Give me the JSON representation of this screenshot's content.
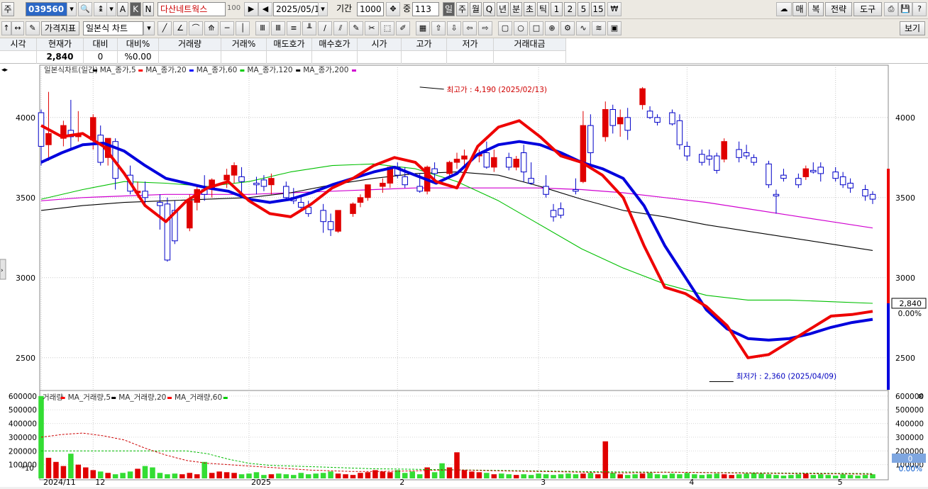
{
  "toolbar1": {
    "type_label": "주",
    "stock_code": "039560",
    "stock_name": "다산네트웍스",
    "name_suffix": "100",
    "date": "2025/05/13",
    "period_label": "기간",
    "period_value": "1000",
    "count_label": "중",
    "count_value": "113",
    "interval_buttons": [
      "일",
      "주",
      "월",
      "Q",
      "년",
      "분",
      "초",
      "틱",
      "1",
      "2",
      "5",
      "15"
    ],
    "right_buttons": [
      "매",
      "복",
      "전략",
      "도구"
    ],
    "a_label": "A",
    "k_label": "K",
    "n_label": "N"
  },
  "toolbar2": {
    "price_index_label": "가격지표",
    "chart_type_label": "일본식 차트",
    "view_label": "보기"
  },
  "info_table": {
    "headers": [
      "시각",
      "현재가",
      "대비",
      "대비%",
      "거래량",
      "거래%",
      "매도호가",
      "매수호가",
      "시가",
      "고가",
      "저가",
      "거래대금"
    ],
    "values": [
      "",
      "2,840",
      "0",
      "%0.00",
      "",
      "",
      "",
      "",
      "",
      "",
      "",
      ""
    ]
  },
  "legend": {
    "price": [
      {
        "name": "일본식차트(일간)",
        "color": "#000000"
      },
      {
        "name": "MA_종가,5",
        "color": "#ff0000"
      },
      {
        "name": "MA_종가,20",
        "color": "#0000ff"
      },
      {
        "name": "MA_종가,60",
        "color": "#00cc00"
      },
      {
        "name": "MA_종가,120",
        "color": "#000000"
      },
      {
        "name": "MA_종가,200",
        "color": "#d000d0"
      }
    ],
    "volume": [
      {
        "name": "거래량",
        "color": "#ff0000"
      },
      {
        "name": "MA_거래량,5",
        "color": "#000000"
      },
      {
        "name": "MA_거래량,20",
        "color": "#ff0000"
      },
      {
        "name": "MA_거래량,60",
        "color": "#00cc00"
      }
    ],
    "volume_multiplier": "*10"
  },
  "chart_data": {
    "type": "candlestick",
    "price_yticks": [
      2500,
      3000,
      3500,
      4000
    ],
    "volume_yticks": [
      100000,
      200000,
      300000,
      400000,
      500000,
      600000
    ],
    "price_ylim": [
      2300,
      4300
    ],
    "volume_ylim": [
      0,
      620000
    ],
    "x_labels": [
      {
        "index": 0,
        "label": "2024/11"
      },
      {
        "index": 7,
        "label": "12"
      },
      {
        "index": 28,
        "label": "2025"
      },
      {
        "index": 48,
        "label": "2"
      },
      {
        "index": 67,
        "label": "3"
      },
      {
        "index": 87,
        "label": "4"
      },
      {
        "index": 107,
        "label": "5"
      }
    ],
    "high_annotation": "최고가 : 4,190 (2025/02/13)",
    "low_annotation": "최저가 : 2,360 (2025/04/09)",
    "high_index": 51,
    "high_value": 4190,
    "low_index": 90,
    "low_value": 2360,
    "current_price_label": "2,840",
    "current_price": 2840,
    "current_change_label": "0.00%",
    "volume_current_label": "0",
    "volume_change_label": "0.00%",
    "candles": [
      {
        "o": 4030,
        "h": 4050,
        "c": 3820,
        "l": 3700
      },
      {
        "o": 3830,
        "h": 4160,
        "c": 3900,
        "l": 3730
      },
      {
        "o": 3870,
        "h": 3980,
        "c": 3950,
        "l": 3820
      },
      {
        "o": 3920,
        "h": 4110,
        "c": 3880,
        "l": 3800
      },
      {
        "o": 3880,
        "h": 4040,
        "c": 3890,
        "l": 3850
      },
      {
        "o": 3860,
        "h": 4020,
        "c": 4000,
        "l": 3800
      },
      {
        "o": 3890,
        "h": 3950,
        "c": 3720,
        "l": 3700
      },
      {
        "o": 3750,
        "h": 3860,
        "c": 3870,
        "l": 3700
      },
      {
        "o": 3850,
        "h": 3870,
        "c": 3620,
        "l": 3550
      },
      {
        "o": 3640,
        "h": 3700,
        "c": 3540,
        "l": 3520
      },
      {
        "o": 3530,
        "h": 3600,
        "c": 3540,
        "l": 3500
      },
      {
        "o": 3540,
        "h": 3600,
        "c": 3500,
        "l": 3450
      },
      {
        "o": 3470,
        "h": 3520,
        "c": 3450,
        "l": 3300
      },
      {
        "o": 3460,
        "h": 3500,
        "c": 3110,
        "l": 3100
      },
      {
        "o": 3420,
        "h": 3480,
        "c": 3230,
        "l": 3210
      },
      {
        "o": 3310,
        "h": 3520,
        "c": 3480,
        "l": 3290
      },
      {
        "o": 3470,
        "h": 3580,
        "c": 3550,
        "l": 3420
      },
      {
        "o": 3550,
        "h": 3640,
        "c": 3520,
        "l": 3480
      },
      {
        "o": 3560,
        "h": 3620,
        "c": 3610,
        "l": 3500
      },
      {
        "o": 3610,
        "h": 3680,
        "c": 3640,
        "l": 3560
      },
      {
        "o": 3640,
        "h": 3720,
        "c": 3700,
        "l": 3590
      },
      {
        "o": 3630,
        "h": 3690,
        "c": 3600,
        "l": 3530
      },
      {
        "o": 3590,
        "h": 3630,
        "c": 3580,
        "l": 3520
      },
      {
        "o": 3610,
        "h": 3640,
        "c": 3570,
        "l": 3540
      },
      {
        "o": 3580,
        "h": 3650,
        "c": 3620,
        "l": 3520
      },
      {
        "o": 3570,
        "h": 3600,
        "c": 3500,
        "l": 3480
      },
      {
        "o": 3500,
        "h": 3560,
        "c": 3480,
        "l": 3460
      },
      {
        "o": 3470,
        "h": 3510,
        "c": 3440,
        "l": 3420
      },
      {
        "o": 3440,
        "h": 3480,
        "c": 3400,
        "l": 3380
      },
      {
        "o": 3420,
        "h": 3460,
        "c": 3350,
        "l": 3280
      },
      {
        "o": 3350,
        "h": 3400,
        "c": 3300,
        "l": 3260
      },
      {
        "o": 3290,
        "h": 3400,
        "c": 3420,
        "l": 3280
      },
      {
        "o": 3400,
        "h": 3470,
        "c": 3460,
        "l": 3380
      },
      {
        "o": 3470,
        "h": 3520,
        "c": 3500,
        "l": 3440
      },
      {
        "o": 3500,
        "h": 3560,
        "c": 3580,
        "l": 3480
      },
      {
        "o": 3570,
        "h": 3620,
        "c": 3590,
        "l": 3530
      },
      {
        "o": 3590,
        "h": 3700,
        "c": 3690,
        "l": 3560
      },
      {
        "o": 3690,
        "h": 3720,
        "c": 3640,
        "l": 3620
      },
      {
        "o": 3630,
        "h": 3690,
        "c": 3580,
        "l": 3560
      },
      {
        "o": 3570,
        "h": 3650,
        "c": 3540,
        "l": 3530
      },
      {
        "o": 3540,
        "h": 3700,
        "c": 3690,
        "l": 3520
      },
      {
        "o": 3680,
        "h": 3720,
        "c": 3650,
        "l": 3610
      },
      {
        "o": 3650,
        "h": 3730,
        "c": 3720,
        "l": 3630
      },
      {
        "o": 3720,
        "h": 3780,
        "c": 3740,
        "l": 3680
      },
      {
        "o": 3740,
        "h": 3800,
        "c": 3760,
        "l": 3700
      },
      {
        "o": 3760,
        "h": 3800,
        "c": 3770,
        "l": 3720
      },
      {
        "o": 3780,
        "h": 3850,
        "c": 3690,
        "l": 3680
      },
      {
        "o": 3690,
        "h": 3800,
        "c": 3750,
        "l": 3660
      },
      {
        "o": 3750,
        "h": 3780,
        "c": 3690,
        "l": 3670
      },
      {
        "o": 3690,
        "h": 3760,
        "c": 3740,
        "l": 3670
      },
      {
        "o": 3780,
        "h": 3830,
        "c": 3660,
        "l": 3600
      },
      {
        "o": 3620,
        "h": 3720,
        "c": 3590,
        "l": 3580
      },
      {
        "o": 3570,
        "h": 3640,
        "c": 3520,
        "l": 3500
      },
      {
        "o": 3420,
        "h": 3460,
        "c": 3380,
        "l": 3350
      },
      {
        "o": 3430,
        "h": 3470,
        "c": 3390,
        "l": 3370
      },
      {
        "o": 3550,
        "h": 3620,
        "c": 3540,
        "l": 3520
      },
      {
        "o": 3600,
        "h": 4040,
        "c": 3950,
        "l": 3590
      },
      {
        "o": 3950,
        "h": 4020,
        "c": 3780,
        "l": 3700
      },
      {
        "o": 3880,
        "h": 4100,
        "c": 4050,
        "l": 3850
      },
      {
        "o": 4050,
        "h": 4080,
        "c": 3950,
        "l": 3900
      },
      {
        "o": 3960,
        "h": 4050,
        "c": 4000,
        "l": 3880
      },
      {
        "o": 4000,
        "h": 4060,
        "c": 3920,
        "l": 3860
      },
      {
        "o": 4080,
        "h": 4190,
        "c": 4180,
        "l": 4050
      },
      {
        "o": 4040,
        "h": 4070,
        "c": 4000,
        "l": 3990
      },
      {
        "o": 4000,
        "h": 4020,
        "c": 3970,
        "l": 3950
      },
      {
        "o": 4030,
        "h": 4050,
        "c": 3960,
        "l": 3950
      },
      {
        "o": 3980,
        "h": 4020,
        "c": 3830,
        "l": 3800
      },
      {
        "o": 3820,
        "h": 3850,
        "c": 3760,
        "l": 3730
      },
      {
        "o": 3770,
        "h": 3800,
        "c": 3720,
        "l": 3700
      },
      {
        "o": 3760,
        "h": 3800,
        "c": 3740,
        "l": 3700
      },
      {
        "o": 3760,
        "h": 3780,
        "c": 3670,
        "l": 3650
      },
      {
        "o": 3740,
        "h": 3870,
        "c": 3850,
        "l": 3720
      },
      {
        "o": 3800,
        "h": 3850,
        "c": 3750,
        "l": 3720
      },
      {
        "o": 3780,
        "h": 3830,
        "c": 3760,
        "l": 3740
      },
      {
        "o": 3750,
        "h": 3770,
        "c": 3720,
        "l": 3700
      },
      {
        "o": 3710,
        "h": 3730,
        "c": 3580,
        "l": 3560
      },
      {
        "o": 3520,
        "h": 3550,
        "c": 3510,
        "l": 3400
      },
      {
        "o": 3640,
        "h": 3680,
        "c": 3620,
        "l": 3600
      },
      {
        "o": 3620,
        "h": 3650,
        "c": 3580,
        "l": 3560
      },
      {
        "o": 3630,
        "h": 3700,
        "c": 3680,
        "l": 3610
      },
      {
        "o": 3670,
        "h": 3720,
        "c": 3660,
        "l": 3650
      },
      {
        "o": 3690,
        "h": 3720,
        "c": 3650,
        "l": 3600
      },
      {
        "o": 3660,
        "h": 3690,
        "c": 3620,
        "l": 3600
      },
      {
        "o": 3630,
        "h": 3660,
        "c": 3580,
        "l": 3560
      },
      {
        "o": 3590,
        "h": 3620,
        "c": 3560,
        "l": 3530
      },
      {
        "o": 3550,
        "h": 3580,
        "c": 3510,
        "l": 3480
      },
      {
        "o": 3520,
        "h": 3540,
        "c": 3490,
        "l": 3460
      }
    ],
    "ma5": [
      3900,
      3880,
      3870,
      3880,
      3900,
      3890,
      3850,
      3800,
      3730,
      3660,
      3600,
      3540,
      3460,
      3370,
      3350,
      3380,
      3430,
      3470,
      3520,
      3560,
      3580,
      3600,
      3600,
      3580,
      3560,
      3540,
      3500,
      3470,
      3430,
      3400,
      3380,
      3390,
      3430,
      3460,
      3510,
      3550,
      3590,
      3620,
      3640,
      3630,
      3640,
      3650,
      3670,
      3690,
      3720,
      3730,
      3740,
      3750,
      3740,
      3730,
      3710,
      3680,
      3620,
      3540,
      3500,
      3560,
      3680,
      3800,
      3870,
      3920,
      3960,
      3980,
      3990,
      3950,
      3900,
      3850,
      3820,
      3780,
      3740,
      3730,
      3720,
      3720,
      3700,
      3650,
      3660,
      3650,
      3640,
      3620,
      3620,
      3600,
      3590,
      3570,
      3540,
      3510,
      3490,
      3470
    ],
    "ma20": [
      3730,
      3760,
      3790,
      3810,
      3830,
      3840,
      3840,
      3830,
      3810,
      3780,
      3740,
      3700,
      3660,
      3630,
      3610,
      3600,
      3590,
      3580,
      3580,
      3570,
      3560,
      3550,
      3530,
      3510,
      3490,
      3480,
      3480,
      3480,
      3490,
      3500,
      3510,
      3520,
      3530,
      3540,
      3560,
      3580,
      3600,
      3620,
      3640,
      3660,
      3680,
      3690,
      3700,
      3690,
      3660,
      3640,
      3630,
      3640,
      3680,
      3720,
      3760,
      3800,
      3830,
      3850,
      3850,
      3850,
      3840,
      3830,
      3810,
      3780,
      3760,
      3740,
      3720,
      3710,
      3700,
      3690,
      3680,
      3670,
      3660,
      3650,
      3640,
      3620,
      3600,
      3580,
      3560,
      3530,
      3500,
      3470
    ],
    "volumes": [
      600000,
      150000,
      120000,
      90000,
      180000,
      100000,
      80000,
      60000,
      50000,
      40000,
      30000,
      40000,
      50000,
      70000,
      90000,
      80000,
      40000,
      30000,
      35000,
      30000,
      40000,
      30000,
      120000,
      40000,
      50000,
      45000,
      40000,
      30000,
      35000,
      45000,
      25000,
      30000,
      35000,
      30000,
      25000,
      40000,
      30000,
      35000,
      40000,
      50000,
      35000,
      30000,
      25000,
      40000,
      45000,
      60000,
      50000,
      45000,
      60000,
      40000,
      50000,
      30000,
      80000,
      45000,
      110000,
      80000,
      190000,
      60000,
      50000,
      45000,
      40000,
      30000,
      35000,
      30000,
      25000,
      30000,
      25000,
      35000,
      30000,
      25000,
      30000,
      35000,
      30000,
      35000,
      40000,
      30000,
      270000,
      40000,
      30000,
      25000,
      30000,
      35000,
      40000,
      30000,
      25000,
      35000,
      30000,
      40000,
      30000,
      25000,
      30000,
      35000,
      30000,
      25000,
      30000,
      35000,
      40000,
      35000,
      30000,
      25000,
      20000,
      25000,
      30000,
      35000,
      25000,
      30000,
      25000,
      20000,
      30000,
      25000,
      20000,
      25000,
      30000
    ]
  }
}
